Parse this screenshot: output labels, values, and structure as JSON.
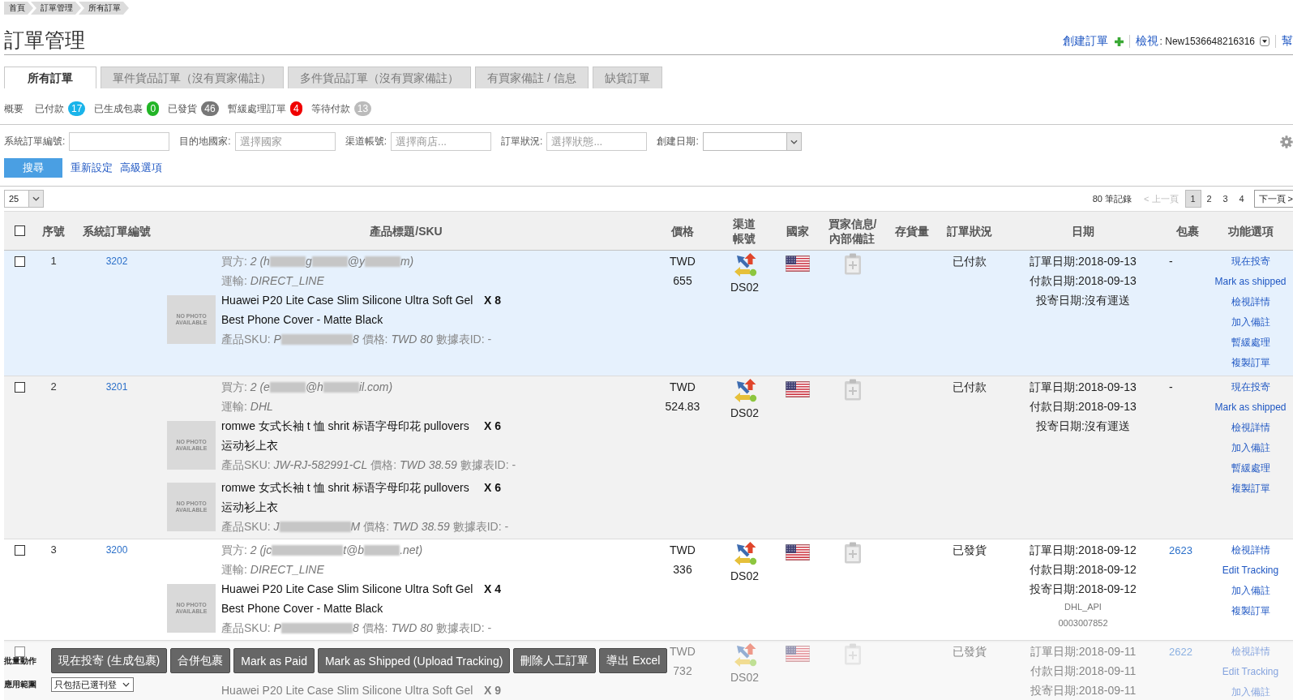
{
  "breadcrumb": [
    {
      "label": "首頁"
    },
    {
      "label": "訂單管理"
    },
    {
      "label": "所有訂單"
    }
  ],
  "page_title": "訂單管理",
  "header_links": {
    "create": "創建訂單",
    "view": {
      "label": "檢視",
      "value": ": New1536648216316"
    },
    "help": "幫"
  },
  "tabs": [
    {
      "label": "所有訂單",
      "selected": true
    },
    {
      "label": "單件貨品訂單（沒有買家備註）",
      "selected": false
    },
    {
      "label": "多件貨品訂單（沒有買家備註）",
      "selected": false
    },
    {
      "label": "有買家備註 / 信息",
      "selected": false
    },
    {
      "label": "缺貨訂單",
      "selected": false
    }
  ],
  "summary": {
    "label": "概要",
    "counts": [
      {
        "label": "已付款",
        "count": "17",
        "color": "#1ab4ea"
      },
      {
        "label": "已生成包裹",
        "count": "0",
        "color": "#22b526"
      },
      {
        "label": "已發貨",
        "count": "46",
        "color": "#777777"
      },
      {
        "label": "暫緩處理訂單",
        "count": "4",
        "color": "#f00000"
      },
      {
        "label": "等待付款",
        "count": "13",
        "color": "#bbbbbb"
      }
    ]
  },
  "filters": [
    {
      "kind": "text",
      "label": "系統訂單編號:"
    },
    {
      "kind": "text",
      "label": "目的地國家:",
      "placeholder": "選擇國家"
    },
    {
      "kind": "text",
      "label": "渠道帳號:",
      "placeholder": "選擇商店..."
    },
    {
      "kind": "text",
      "label": "訂單狀況:",
      "placeholder": "選擇狀態..."
    },
    {
      "kind": "select",
      "label": "創建日期:"
    }
  ],
  "search": {
    "button": "搜尋",
    "links": [
      "重新設定",
      "高級選項"
    ]
  },
  "pager": {
    "page_size": "25",
    "total": "80 筆記錄",
    "prev": {
      "label": "< 上一頁",
      "disabled": true
    },
    "pages": [
      {
        "label": "1",
        "selected": true
      },
      {
        "label": "2",
        "selected": false
      },
      {
        "label": "3",
        "selected": false
      },
      {
        "label": "4",
        "selected": false
      }
    ],
    "next": {
      "label": "下一頁 >",
      "disabled": false
    }
  },
  "table": {
    "columns": [
      {
        "kind": "checkbox",
        "checked": false
      },
      {
        "kind": "text",
        "label": "序號"
      },
      {
        "kind": "text",
        "label": "系統訂單編號"
      },
      {
        "kind": "text",
        "label": "產品標題/SKU"
      },
      {
        "kind": "text",
        "label": "價格"
      },
      {
        "kind": "text",
        "label": "渠道帳號"
      },
      {
        "kind": "text",
        "label": "國家"
      },
      {
        "kind": "text",
        "label": "買家信息/內部備註"
      },
      {
        "kind": "text",
        "label": "存貨量"
      },
      {
        "kind": "text",
        "label": "訂單狀況"
      },
      {
        "kind": "text",
        "label": "日期"
      },
      {
        "kind": "text",
        "label": "包裹"
      },
      {
        "kind": "text",
        "label": "功能選項"
      }
    ],
    "rows": [
      {
        "highlighted": true,
        "checked": false,
        "number": "1",
        "order_id": "3202",
        "buyer": [
          {
            "kind": "label",
            "text": "買方:"
          },
          {
            "kind": "value",
            "text": "2 (h"
          },
          {
            "kind": "redacted"
          },
          {
            "kind": "value",
            "text": "g"
          },
          {
            "kind": "redacted"
          },
          {
            "kind": "value",
            "text": "@y"
          },
          {
            "kind": "redacted"
          },
          {
            "kind": "value",
            "text": "m)"
          }
        ],
        "shipping": [
          {
            "kind": "label",
            "text": "運輸:"
          },
          {
            "kind": "value",
            "text": "DIRECT_LINE"
          }
        ],
        "items": [
          {
            "photo_label": "NO PHOTO AVAILABLE",
            "title": "Huawei P20 Lite Case Slim Silicone Ultra Soft Gel Best Phone Cover - Matte Black",
            "qty": "X 8",
            "sku": [
              {
                "kind": "label",
                "text": "產品SKU:"
              },
              {
                "kind": "value",
                "text": "P"
              },
              {
                "kind": "longredacted"
              },
              {
                "kind": "value",
                "text": "8"
              },
              {
                "kind": "label",
                "text": "價格:"
              },
              {
                "kind": "value",
                "text": "TWD 80"
              },
              {
                "kind": "label",
                "text": "數據表ID: -"
              }
            ]
          }
        ],
        "currency": "TWD",
        "amount": "655",
        "channel": "DS02",
        "status": "已付款",
        "dates": [
          "訂單日期:2018-09-13",
          "付款日期:2018-09-13",
          "投寄日期:沒有運送"
        ],
        "package": {
          "kind": "plain",
          "text": "-"
        },
        "actions": [
          "現在投寄",
          "Mark as shipped",
          "檢視詳情",
          "加入備註",
          "暫緩處理",
          "複製訂單"
        ]
      },
      {
        "highlighted": false,
        "checked": false,
        "number": "2",
        "order_id": "3201",
        "buyer": [
          {
            "kind": "label",
            "text": "買方:"
          },
          {
            "kind": "value",
            "text": "2 (e"
          },
          {
            "kind": "redacted"
          },
          {
            "kind": "value",
            "text": "@h"
          },
          {
            "kind": "redacted"
          },
          {
            "kind": "value",
            "text": "il.com)"
          }
        ],
        "shipping": [
          {
            "kind": "label",
            "text": "運輸:"
          },
          {
            "kind": "value",
            "text": "DHL"
          }
        ],
        "items": [
          {
            "photo_label": "NO PHOTO AVAILABLE",
            "title": "romwe 女式长袖 t 恤 shrit 标语字母印花 pullovers 运动衫上衣",
            "qty": "X 6",
            "sku": [
              {
                "kind": "label",
                "text": "產品SKU:"
              },
              {
                "kind": "value",
                "text": "JW-RJ-582991-CL"
              },
              {
                "kind": "label",
                "text": "價格:"
              },
              {
                "kind": "value",
                "text": "TWD 38.59"
              },
              {
                "kind": "label",
                "text": "數據表ID: -"
              }
            ]
          },
          {
            "photo_label": "NO PHOTO AVAILABLE",
            "title": "romwe 女式长袖 t 恤 shrit 标语字母印花 pullovers 运动衫上衣",
            "qty": "X 6",
            "sku": [
              {
                "kind": "label",
                "text": "產品SKU:"
              },
              {
                "kind": "value",
                "text": "J"
              },
              {
                "kind": "longredacted"
              },
              {
                "kind": "value",
                "text": "M"
              },
              {
                "kind": "label",
                "text": "價格:"
              },
              {
                "kind": "value",
                "text": "TWD 38.59"
              },
              {
                "kind": "label",
                "text": "數據表ID: -"
              }
            ]
          }
        ],
        "currency": "TWD",
        "amount": "524.83",
        "channel": "DS02",
        "status": "已付款",
        "dates": [
          "訂單日期:2018-09-13",
          "付款日期:2018-09-13",
          "投寄日期:沒有運送"
        ],
        "package": {
          "kind": "plain",
          "text": "-"
        },
        "actions": [
          "現在投寄",
          "Mark as shipped",
          "檢視詳情",
          "加入備註",
          "暫緩處理",
          "複製訂單"
        ]
      },
      {
        "highlighted": false,
        "checked": false,
        "number": "3",
        "order_id": "3200",
        "buyer": [
          {
            "kind": "label",
            "text": "買方:"
          },
          {
            "kind": "value",
            "text": "2 (jc"
          },
          {
            "kind": "longredacted"
          },
          {
            "kind": "value",
            "text": "t@b"
          },
          {
            "kind": "redacted"
          },
          {
            "kind": "value",
            "text": ".net)"
          }
        ],
        "shipping": [
          {
            "kind": "label",
            "text": "運輸:"
          },
          {
            "kind": "value",
            "text": "DIRECT_LINE"
          }
        ],
        "items": [
          {
            "photo_label": "NO PHOTO AVAILABLE",
            "title": "Huawei P20 Lite Case Slim Silicone Ultra Soft Gel Best Phone Cover - Matte Black",
            "qty": "X 4",
            "sku": [
              {
                "kind": "label",
                "text": "產品SKU:"
              },
              {
                "kind": "value",
                "text": "P"
              },
              {
                "kind": "longredacted"
              },
              {
                "kind": "value",
                "text": "8"
              },
              {
                "kind": "label",
                "text": "價格:"
              },
              {
                "kind": "value",
                "text": "TWD 80"
              },
              {
                "kind": "label",
                "text": "數據表ID: -"
              }
            ]
          }
        ],
        "currency": "TWD",
        "amount": "336",
        "channel": "DS02",
        "status": "已發貨",
        "dates": [
          "訂單日期:2018-09-12",
          "付款日期:2018-09-12",
          "投寄日期:2018-09-12"
        ],
        "tracking": [
          "DHL_API",
          "0003007852"
        ],
        "package": {
          "kind": "link",
          "text": "2623"
        },
        "actions": [
          "檢視詳情",
          "Edit Tracking",
          "加入備註",
          "複製訂單"
        ]
      },
      {
        "highlighted": false,
        "checked": false,
        "items": [
          {
            "title": "Huawei P20 Lite Case Slim Silicone Ultra Soft Gel",
            "qty": "X 9"
          }
        ],
        "currency": "TWD",
        "amount": "732",
        "channel": "DS02",
        "status": "已發貨",
        "dates": [
          "訂單日期:2018-09-11",
          "付款日期:2018-09-11",
          "投寄日期:2018-09-11"
        ],
        "package": {
          "kind": "link",
          "text": "2622"
        },
        "actions": [
          "檢視詳情",
          "Edit Tracking",
          "加入備註"
        ]
      }
    ]
  },
  "bulk_bar": {
    "label": "批量動作",
    "buttons": [
      "現在投寄 (生成包裹)",
      "合併包裹",
      "Mark as Paid",
      "Mark as Shipped (Upload Tracking)",
      "刪除人工訂單",
      "導出 Excel"
    ],
    "scope_label": "應用範圍",
    "scope_value": "只包括已選刊登"
  }
}
